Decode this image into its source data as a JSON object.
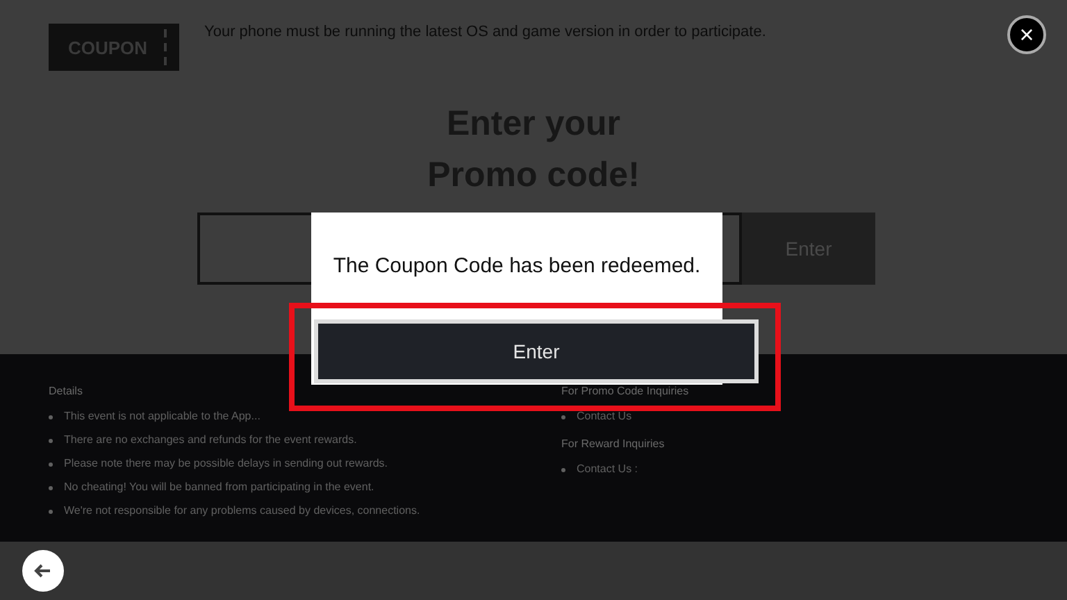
{
  "coupon_badge": "COUPON",
  "notice": "Your phone must be running the latest OS and game version in order to participate.",
  "close_button": "×",
  "heading": [
    "Enter your",
    "Promo code!"
  ],
  "promo_form": {
    "button": "Enter"
  },
  "details": {
    "title": "Details",
    "items": [
      "This event is not applicable to the App...",
      "There are no exchanges and refunds for the event rewards.",
      "Please note there may be possible delays in sending out rewards.",
      "No cheating! You will be banned from participating in the event.",
      "We're not responsible for any problems caused by devices, connections."
    ]
  },
  "inquiries": [
    {
      "title": "For Promo Code Inquiries",
      "items": [
        "Contact Us"
      ]
    },
    {
      "title": "For Reward Inquiries",
      "items": [
        "Contact Us :"
      ]
    }
  ],
  "dialog": {
    "message": "The Coupon Code has been redeemed.",
    "button": "Enter",
    "highlighted": true
  }
}
